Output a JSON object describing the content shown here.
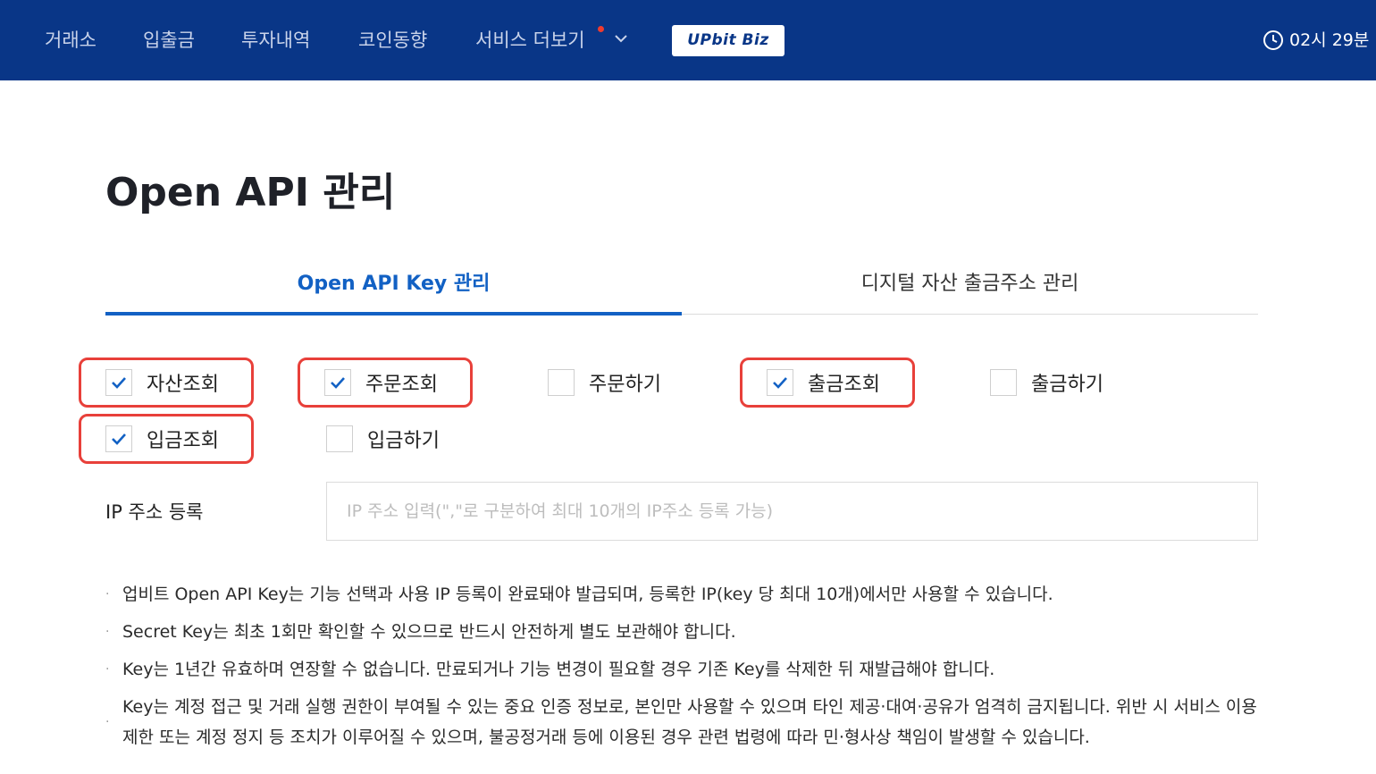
{
  "nav": {
    "items": [
      "거래소",
      "입출금",
      "투자내역",
      "코인동향",
      "서비스 더보기"
    ],
    "biz_badge": "UPbit Biz",
    "clock": "02시 29분"
  },
  "page": {
    "title": "Open API 관리"
  },
  "tabs": [
    {
      "label": "Open API Key 관리",
      "active": true
    },
    {
      "label": "디지털 자산 출금주소 관리",
      "active": false
    }
  ],
  "permissions": [
    {
      "label": "자산조회",
      "checked": true
    },
    {
      "label": "주문조회",
      "checked": true
    },
    {
      "label": "주문하기",
      "checked": false
    },
    {
      "label": "출금조회",
      "checked": true
    },
    {
      "label": "출금하기",
      "checked": false
    },
    {
      "label": "입금조회",
      "checked": true
    },
    {
      "label": "입금하기",
      "checked": false
    }
  ],
  "ip": {
    "label": "IP 주소 등록",
    "placeholder": "IP 주소 입력(\",\"로 구분하여 최대 10개의 IP주소 등록 가능)",
    "value": ""
  },
  "notes": [
    "업비트 Open API Key는 기능 선택과 사용 IP 등록이 완료돼야 발급되며, 등록한 IP(key 당 최대 10개)에서만 사용할 수 있습니다.",
    "Secret Key는 최초 1회만 확인할 수 있으므로 반드시 안전하게 별도 보관해야 합니다.",
    "Key는 1년간 유효하며 연장할 수 없습니다. 만료되거나 기능 변경이 필요할 경우 기존 Key를 삭제한 뒤 재발급해야 합니다.",
    "Key는 계정 접근 및 거래 실행 권한이 부여될 수 있는 중요 인증 정보로, 본인만 사용할 수 있으며 타인 제공·대여·공유가 엄격히 금지됩니다. 위반 시 서비스 이용 제한 또는 계정 정지 등 조치가 이루어질 수 있으며, 불공정거래 등에 이용된 경우 관련 법령에 따라 민·형사상 책임이 발생할 수 있습니다."
  ],
  "colors": {
    "nav_bg": "#093687",
    "accent": "#1261c4",
    "highlight": "#e8403a"
  },
  "icons": {
    "chevron": "chevron-down-icon",
    "clock": "clock-icon",
    "check": "check-icon"
  }
}
